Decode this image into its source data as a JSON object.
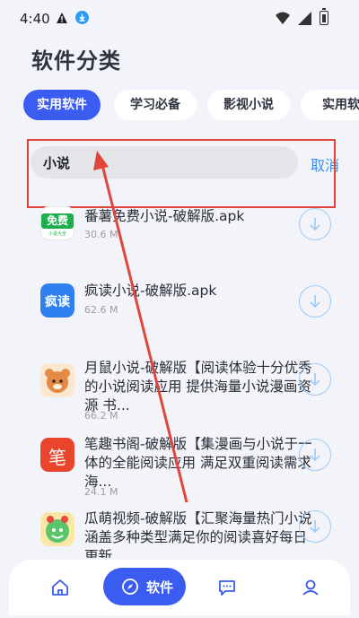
{
  "status_bar": {
    "time": "4:40"
  },
  "page": {
    "title": "软件分类"
  },
  "tabs": [
    {
      "label": "实用软件",
      "active": true
    },
    {
      "label": "学习必备",
      "active": false
    },
    {
      "label": "影视小说",
      "active": false
    },
    {
      "label": "实用软",
      "active": false
    }
  ],
  "search": {
    "value": "小说",
    "cancel_label": "取消"
  },
  "apps": [
    {
      "title": "番薯免费小说-破解版.apk",
      "size": "30.6 M",
      "icon": "fanshu-app-icon",
      "icon_text": "免费",
      "icon_subtext": "小说大全"
    },
    {
      "title": "疯读小说-破解版.apk",
      "size": "62.6 M",
      "icon": "fengdu-app-icon",
      "icon_text": "疯读"
    },
    {
      "title": "月鼠小说-破解版【阅读体验十分优秀的小说阅读应用 提供海量小说漫画资源 书...",
      "size": "66.2 M",
      "icon": "yueshu-app-icon"
    },
    {
      "title": "笔趣书阁-破解版【集漫画与小说于一体的全能阅读应用 满足双重阅读需求 海...",
      "size": "24.1 M",
      "icon": "biqu-app-icon",
      "icon_text": "笔"
    },
    {
      "title": "瓜萌视频-破解版【汇聚海量热门小说涵盖多种类型满足你的阅读喜好每日更新...",
      "size": "",
      "icon": "guameng-app-icon"
    }
  ],
  "bottom_nav": {
    "center_label": "软件"
  },
  "colors": {
    "accent": "#3a5cf0",
    "link": "#3a8ef0",
    "annotation": "#e0453a"
  }
}
